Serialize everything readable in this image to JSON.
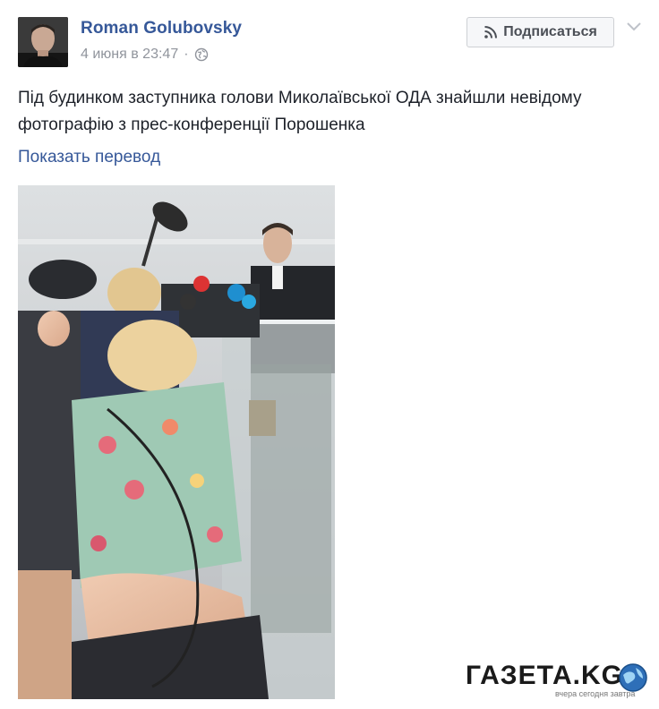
{
  "post": {
    "author": "Roman Golubovsky",
    "timestamp": "4 июня в 23:47",
    "separator": "·",
    "privacy_icon": "globe-icon",
    "subscribe_label": "Подписаться",
    "subscribe_icon": "rss-icon",
    "menu_icon": "chevron-down-icon",
    "text": "Під будинком заступника голови Миколаївської ОДА знайшли невідому фотографію з прес-конференції Порошенка",
    "translate_link": "Показать перевод"
  },
  "watermark": {
    "logo_text": "ГАЗЕТА.KG",
    "tagline": "вчера сегодня завтра"
  },
  "colors": {
    "link": "#365899",
    "meta": "#90949c",
    "text": "#1d2129",
    "button_bg": "#f6f7f9",
    "button_border": "#ced0d4"
  }
}
